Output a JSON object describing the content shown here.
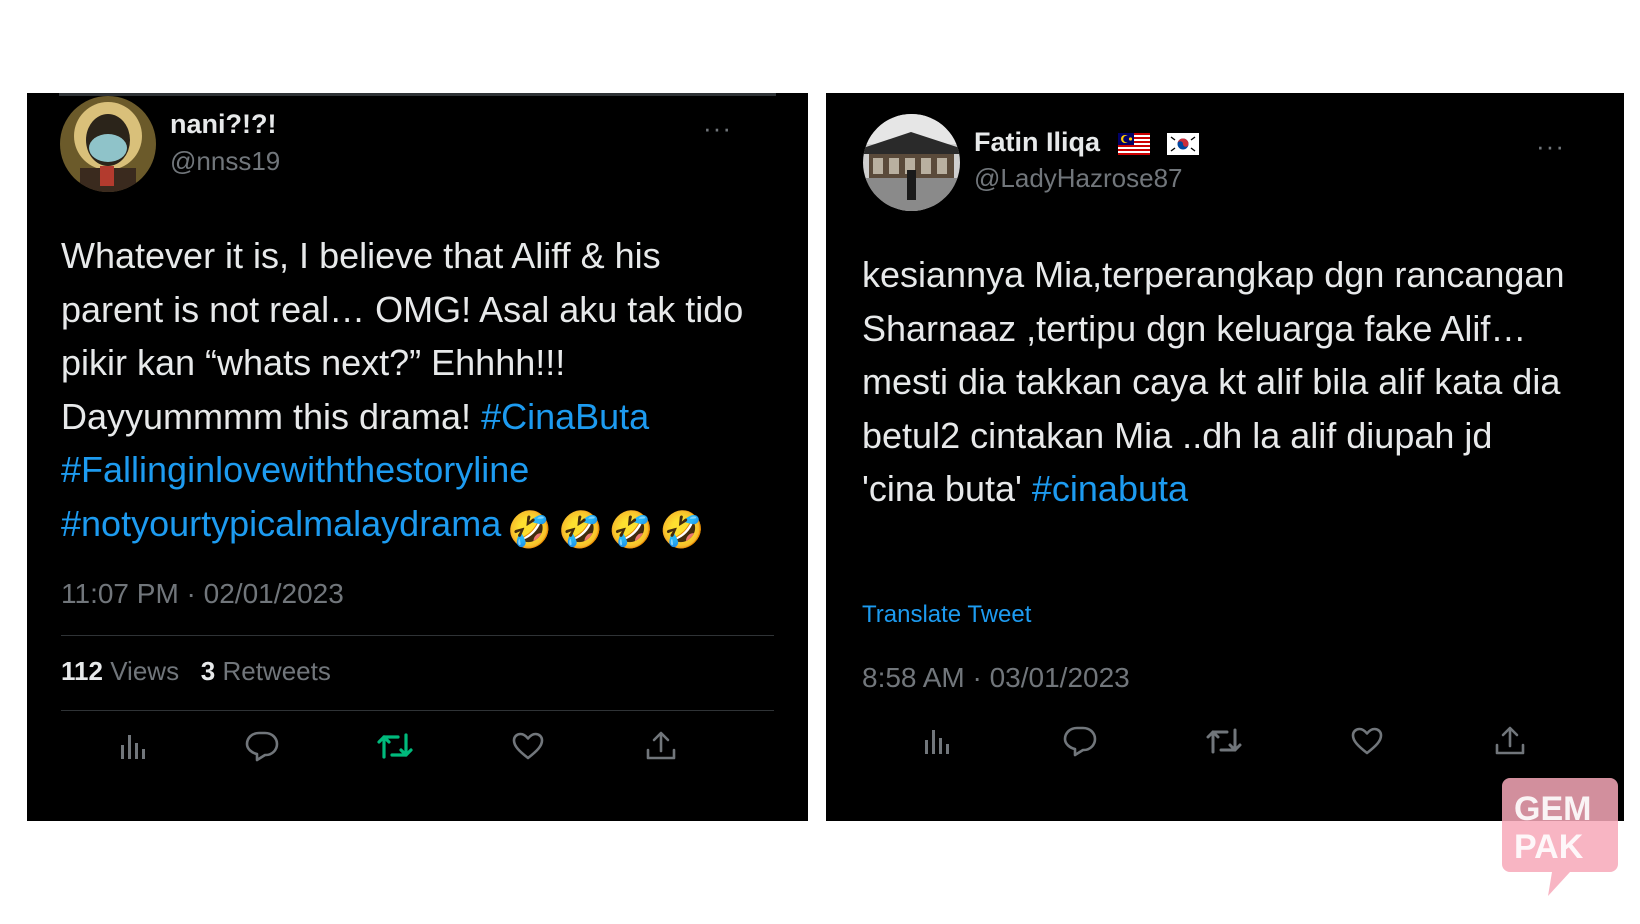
{
  "tweets": [
    {
      "display_name": "nani?!?!",
      "handle": "@nnss19",
      "more": "···",
      "text": "Whatever it is, I believe that Aliff & his parent is not real… OMG! Asal aku tak tido pikir kan “whats next?” Ehhhh!!! Dayyummmm this drama!",
      "hashtags": [
        "#CinaButa",
        "#Fallinginlovewiththestoryline",
        "#notyourtypicalmalaydrama"
      ],
      "emojis": [
        "🤣",
        "🤣",
        "🤣",
        "🤣"
      ],
      "timestamp": "11:07 PM · 02/01/2023",
      "views_count": "112",
      "views_label": "Views",
      "retweets_count": "3",
      "retweets_label": "Retweets",
      "retweet_active_color": "#00ba7c"
    },
    {
      "display_name": "Fatin Iliqa",
      "flags": [
        "malaysia-flag-icon",
        "south-korea-flag-icon"
      ],
      "handle": "@LadyHazrose87",
      "more": "···",
      "text": "kesiannya Mia,terperangkap dgn rancangan Sharnaaz ,tertipu dgn keluarga fake Alif…mesti dia takkan caya kt alif bila alif kata dia betul2 cintakan Mia ..dh la alif diupah jd 'cina buta'",
      "hashtags": [
        "#cinabuta"
      ],
      "translate": "Translate Tweet",
      "timestamp": "8:58 AM · 03/01/2023"
    }
  ],
  "watermark": {
    "line1": "GEM",
    "line2": "PAK",
    "color": "#f7a8b8"
  },
  "colors": {
    "background": "#000000",
    "text": "#e7e9ea",
    "muted": "#71767b",
    "link": "#1d9bf0",
    "divider": "#2f3336"
  }
}
